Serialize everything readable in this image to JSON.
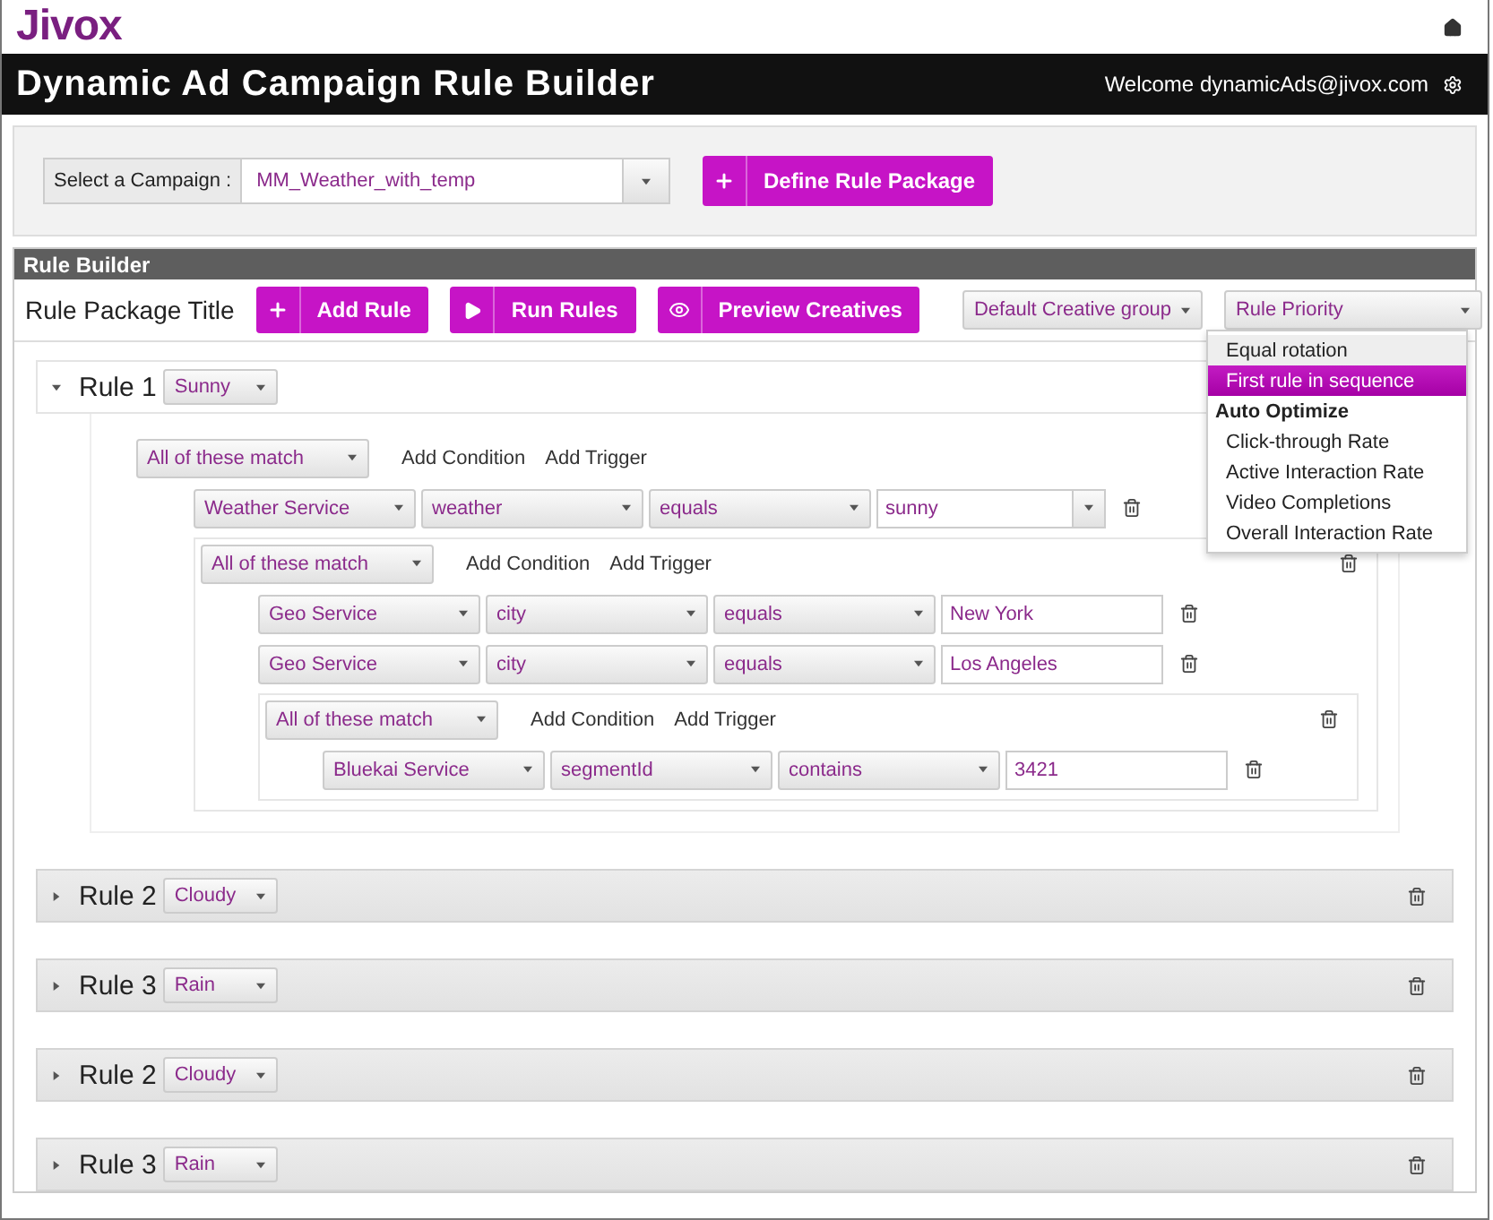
{
  "header": {
    "logo": "Jivox",
    "title": "Dynamic Ad Campaign Rule Builder",
    "welcome": "Welcome dynamicAds@jivox.com"
  },
  "campaign": {
    "label": "Select a Campaign :",
    "value": "MM_Weather_with_temp",
    "button": "Define Rule Package"
  },
  "rule_builder": {
    "title": "Rule Builder",
    "package_title": "Rule Package Title",
    "buttons": [
      {
        "label": "Add Rule",
        "kind": "add"
      },
      {
        "label": "Run Rules",
        "kind": "run"
      },
      {
        "label": "Preview Creatives",
        "kind": "preview"
      }
    ],
    "creative_group": "Default Creative group",
    "priority": {
      "label": "Rule Priority",
      "expanded": true,
      "items": [
        {
          "label": "Equal rotation",
          "kind": "option",
          "selected": false
        },
        {
          "label": "First rule in sequence",
          "kind": "option",
          "selected": true
        },
        {
          "label": "Auto Optimize",
          "kind": "heading",
          "selected": false
        },
        {
          "label": "Click-through Rate",
          "kind": "option",
          "selected": false
        },
        {
          "label": "Active Interaction Rate",
          "kind": "option",
          "selected": false
        },
        {
          "label": "Video Completions",
          "kind": "option",
          "selected": false
        },
        {
          "label": "Overall Interaction Rate",
          "kind": "option",
          "selected": false
        }
      ]
    }
  },
  "rules": [
    {
      "title": "Rule 1",
      "tag": "Sunny",
      "expanded": true,
      "deletable": false,
      "group": {
        "match": "All of these match",
        "actions": [
          "Add Condition",
          "Add Trigger"
        ],
        "deletable": false,
        "items": [
          {
            "kind": "condition",
            "service": "Weather Service",
            "field": "weather",
            "operator": "equals",
            "value": {
              "text": "sunny",
              "kind": "combo"
            }
          },
          {
            "kind": "group",
            "match": "All of these match",
            "actions": [
              "Add Condition",
              "Add Trigger"
            ],
            "deletable": true,
            "items": [
              {
                "kind": "condition",
                "service": "Geo Service",
                "field": "city",
                "operator": "equals",
                "value": {
                  "text": "New York",
                  "kind": "text"
                }
              },
              {
                "kind": "condition",
                "service": "Geo Service",
                "field": "city",
                "operator": "equals",
                "value": {
                  "text": "Los Angeles",
                  "kind": "text"
                }
              },
              {
                "kind": "group",
                "match": "All of these match",
                "actions": [
                  "Add Condition",
                  "Add Trigger"
                ],
                "deletable": true,
                "items": [
                  {
                    "kind": "condition",
                    "service": "Bluekai Service",
                    "field": "segmentId",
                    "operator": "contains",
                    "value": {
                      "text": "3421",
                      "kind": "text"
                    }
                  }
                ]
              }
            ]
          }
        ]
      }
    },
    {
      "title": "Rule 2",
      "tag": "Cloudy",
      "expanded": false,
      "deletable": true
    },
    {
      "title": "Rule 3",
      "tag": "Rain",
      "expanded": false,
      "deletable": true
    },
    {
      "title": "Rule 2",
      "tag": "Cloudy",
      "expanded": false,
      "deletable": true
    },
    {
      "title": "Rule 3",
      "tag": "Rain",
      "expanded": false,
      "deletable": true
    }
  ]
}
